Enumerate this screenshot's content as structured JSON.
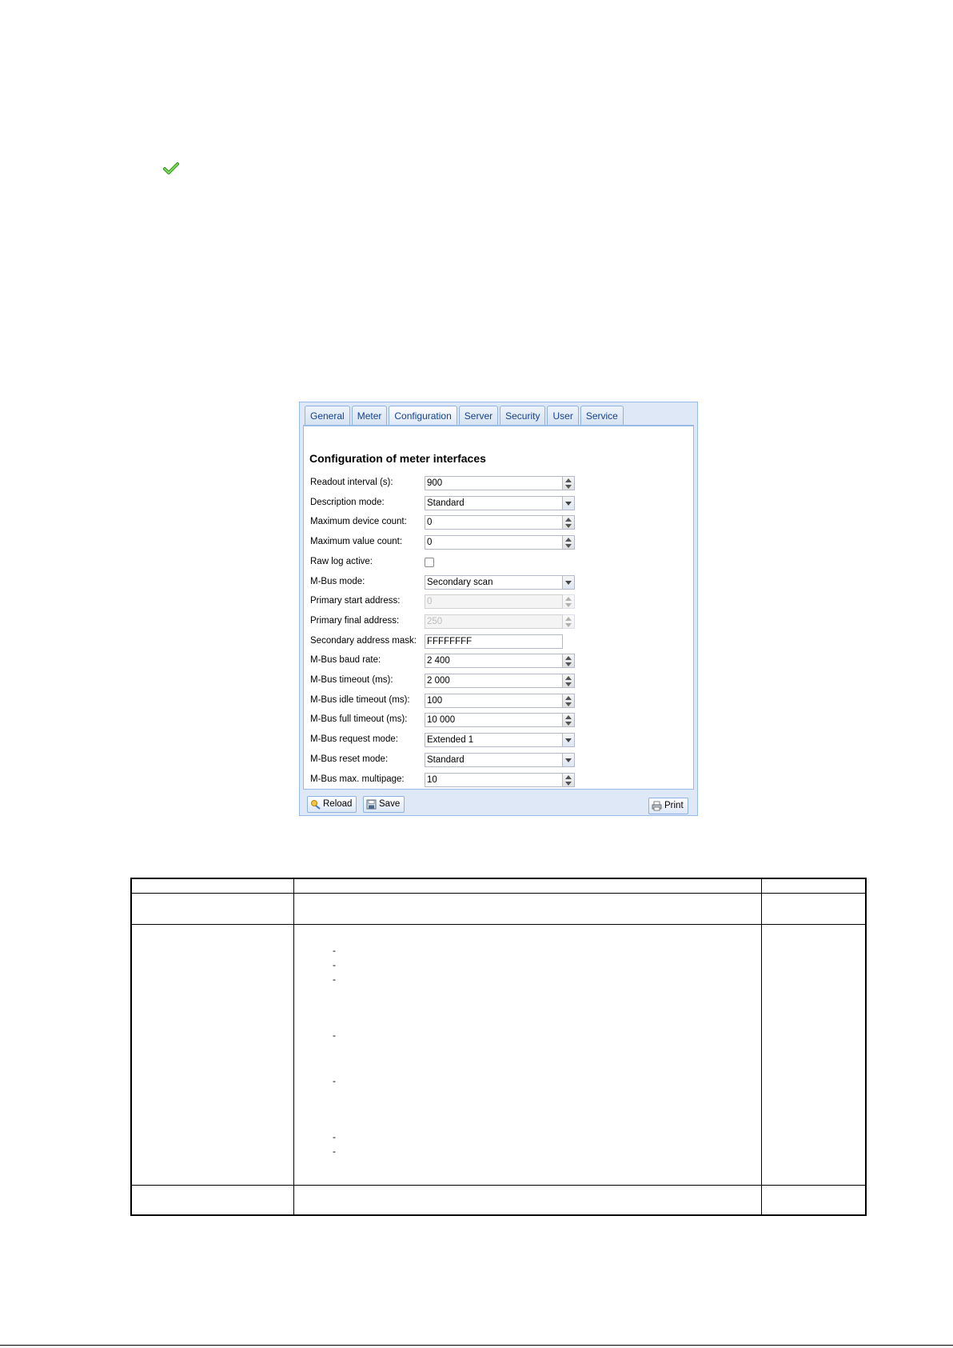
{
  "window": {
    "tabs": [
      {
        "label": "General"
      },
      {
        "label": "Meter"
      },
      {
        "label": "Configuration",
        "active": true
      },
      {
        "label": "Server"
      },
      {
        "label": "Security"
      },
      {
        "label": "User"
      },
      {
        "label": "Service"
      }
    ],
    "form_title": "Configuration of meter interfaces",
    "fields": [
      {
        "label": "Readout interval (s):",
        "value": "900",
        "control": "spinner"
      },
      {
        "label": "Description mode:",
        "value": "Standard",
        "control": "combo"
      },
      {
        "label": "Maximum device count:",
        "value": "0",
        "control": "spinner"
      },
      {
        "label": "Maximum value count:",
        "value": "0",
        "control": "spinner"
      },
      {
        "label": "Raw log active:",
        "value": "",
        "control": "checkbox"
      },
      {
        "label": "M-Bus mode:",
        "value": "Secondary scan",
        "control": "combo"
      },
      {
        "label": "Primary start address:",
        "value": "0",
        "control": "spinner",
        "disabled": true
      },
      {
        "label": "Primary final address:",
        "value": "250",
        "control": "spinner",
        "disabled": true
      },
      {
        "label": "Secondary address mask:",
        "value": "FFFFFFFF",
        "control": "text"
      },
      {
        "label": "M-Bus baud rate:",
        "value": "2 400",
        "control": "spinner"
      },
      {
        "label": "M-Bus timeout (ms):",
        "value": "2 000",
        "control": "spinner"
      },
      {
        "label": "M-Bus idle timeout (ms):",
        "value": "100",
        "control": "spinner"
      },
      {
        "label": "M-Bus full timeout (ms):",
        "value": "10 000",
        "control": "spinner"
      },
      {
        "label": "M-Bus request mode:",
        "value": "Extended 1",
        "control": "combo"
      },
      {
        "label": "M-Bus reset mode:",
        "value": "Standard",
        "control": "combo"
      },
      {
        "label": "M-Bus max. multipage:",
        "value": "10",
        "control": "spinner"
      }
    ],
    "buttons": {
      "reload": "Reload",
      "save": "Save",
      "print": "Print"
    }
  },
  "table": {
    "dash": "-"
  },
  "colors": {
    "accent": "#15428b",
    "panel_bg": "#dfe8f6",
    "panel_border": "#99bbe8",
    "check_green": "#4caf2a"
  }
}
